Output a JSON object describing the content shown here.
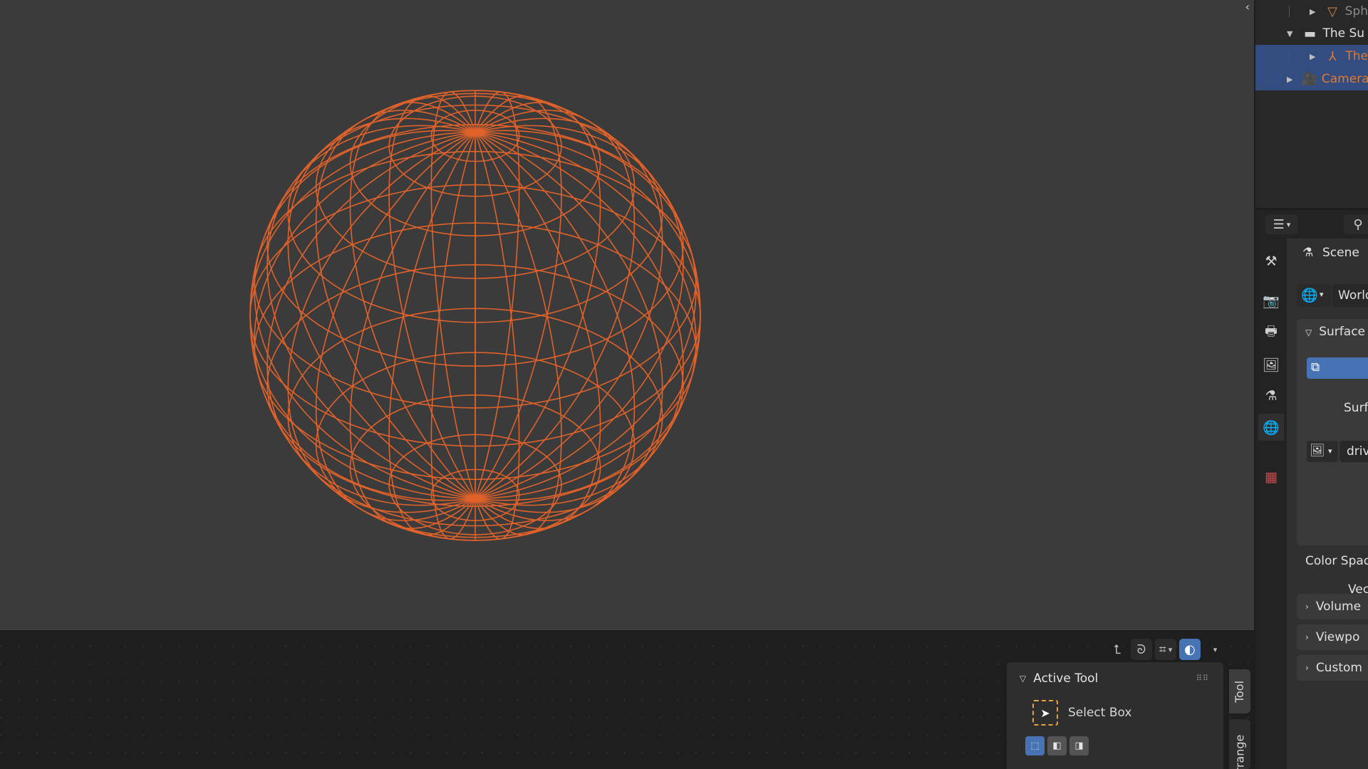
{
  "outliner": {
    "rows": [
      {
        "label": "Sph",
        "icon": "mesh-icon",
        "color": "#8a8a8a"
      },
      {
        "label": "The Su",
        "icon": "collection-icon",
        "color": "#e0e0e0"
      },
      {
        "label": "The",
        "icon": "empty-icon",
        "color": "#e07a2e"
      },
      {
        "label": "Camera",
        "icon": "camera-icon",
        "color": "#e07a2e"
      }
    ]
  },
  "properties": {
    "scene_label": "Scene",
    "world_field": "World",
    "surface_panel": "Surface",
    "surface_label": "Surf",
    "image_field": "driv",
    "color_space_label": "Color Spac",
    "vector_label": "Vec",
    "volume_panel": "Volume",
    "viewport_panel": "Viewpo",
    "custom_panel": "Custom"
  },
  "node_editor": {
    "active_tool_header": "Active Tool",
    "tool_name": "Select Box",
    "tabs": [
      "Tool",
      "Arrange"
    ]
  },
  "colors": {
    "wire": "#e0622a",
    "viewport_bg": "#3b3b3b",
    "selected_row": "#334d80",
    "accent_blue": "#4772b3"
  }
}
